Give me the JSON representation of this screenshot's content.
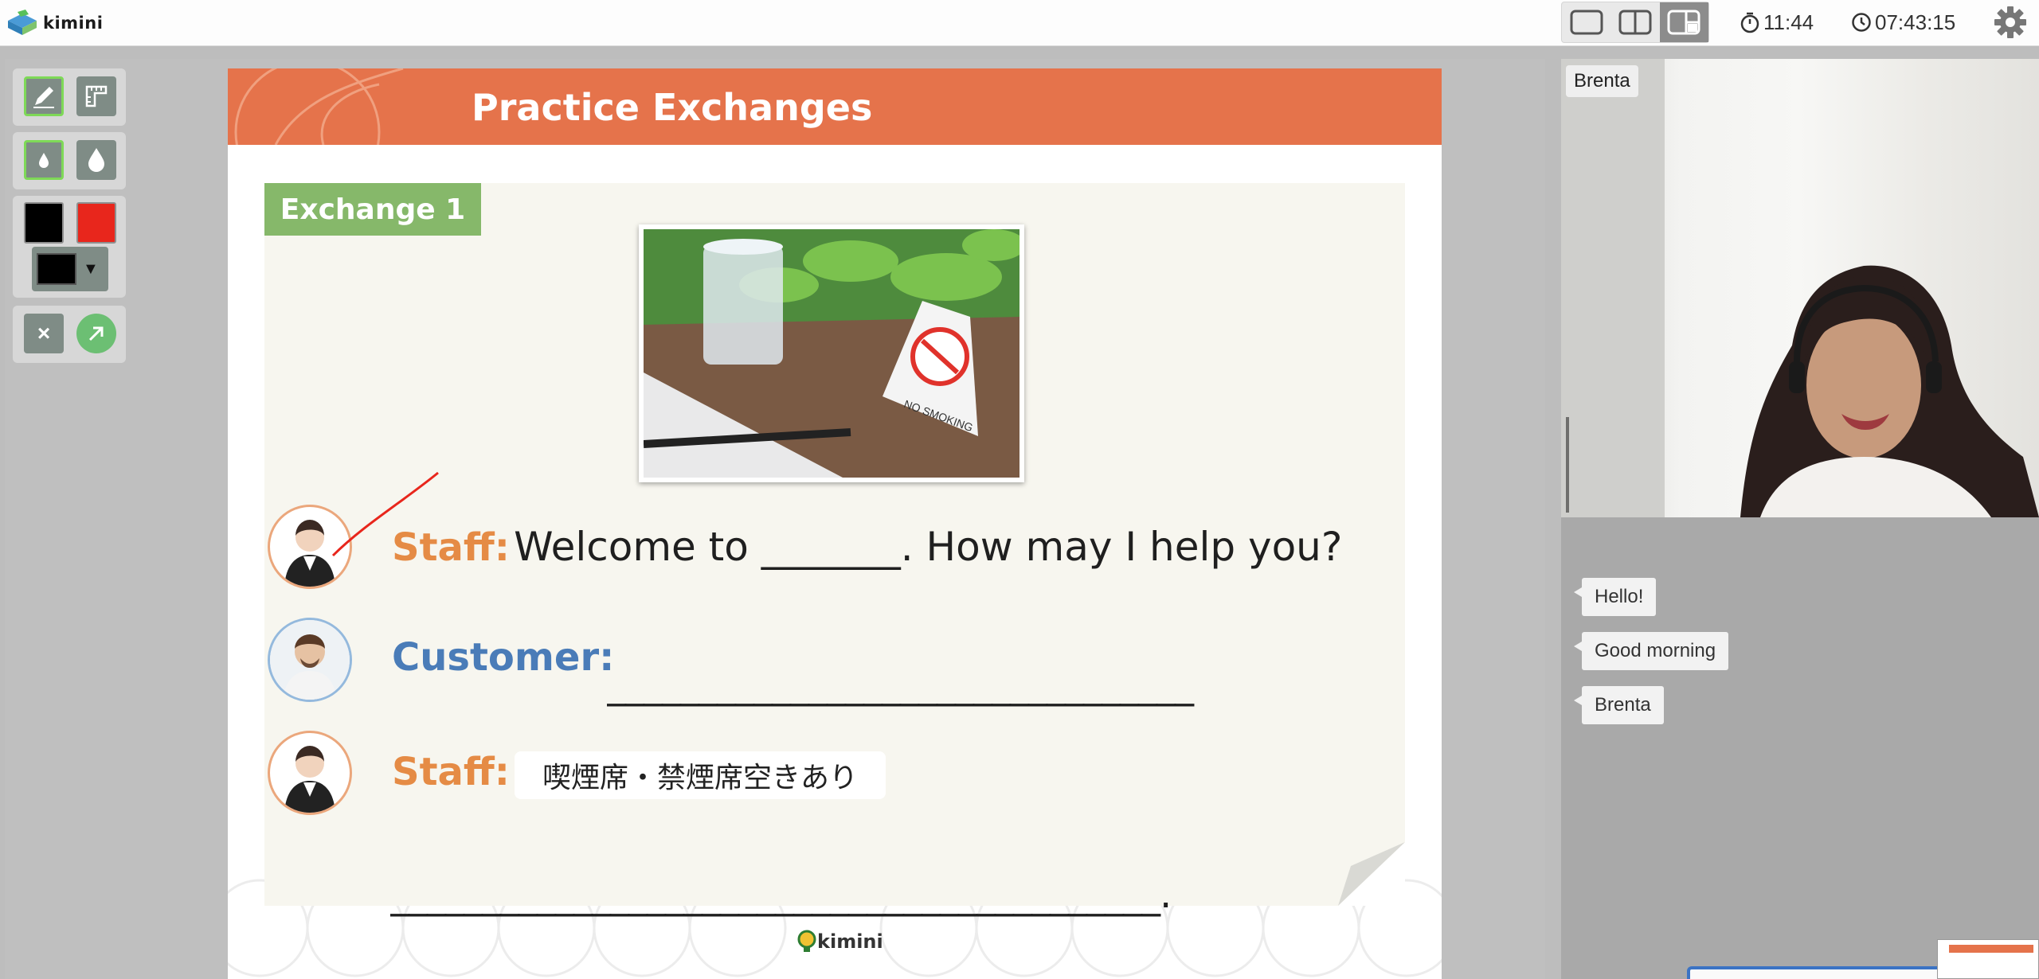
{
  "app": {
    "name": "kimini"
  },
  "topbar": {
    "layouts": [
      "single-view",
      "split-view",
      "board-video-view"
    ],
    "active_layout": 2,
    "lesson_timer": "11:44",
    "clock": "07:43:15"
  },
  "tools": {
    "pen": "pen-icon",
    "ruler": "ruler-icon",
    "thin": "thin-drop-icon",
    "thick": "thick-drop-icon",
    "color_black": "#000000",
    "color_red": "#e8261c",
    "current_color": "#000000",
    "clear": "×",
    "arrow": "arrow-icon"
  },
  "slide": {
    "title": "Practice Exchanges",
    "tag": "Exchange 1",
    "photo_sign": "NO SMOKING",
    "lines": [
      {
        "role": "Staff:",
        "text": "Welcome to _______. How may I help you?"
      },
      {
        "role": "Customer:",
        "text": "________________________________"
      },
      {
        "role": "Staff:",
        "hint": "喫煙席・禁煙席空きあり",
        "text": "__________________________________________."
      }
    ],
    "footer_brand": "kimini"
  },
  "video": {
    "participant": "Brenta"
  },
  "chat": [
    "Hello!",
    "Good morning",
    "Brenta"
  ]
}
